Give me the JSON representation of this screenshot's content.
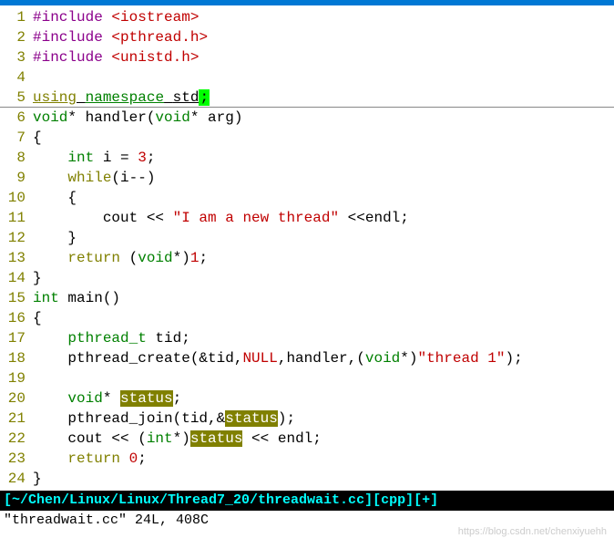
{
  "lines": {
    "l1": {
      "n": "1",
      "preproc": "#include ",
      "header": "<iostream>"
    },
    "l2": {
      "n": "2",
      "preproc": "#include ",
      "header": "<pthread.h>"
    },
    "l3": {
      "n": "3",
      "preproc": "#include ",
      "header": "<unistd.h>"
    },
    "l4": {
      "n": "4"
    },
    "l5": {
      "n": "5",
      "kw1": "using",
      "sp1": " ",
      "kw2": "namespace",
      "sp2": " ",
      "ns": "std",
      "semi": ";"
    },
    "l6": {
      "n": "6",
      "t1": "void",
      "p1": "* handler(",
      "t2": "void",
      "p2": "* arg)"
    },
    "l7": {
      "n": "7",
      "p": "{"
    },
    "l8": {
      "n": "8",
      "pad": "    ",
      "t": "int",
      "p": " i = ",
      "num": "3",
      "semi": ";"
    },
    "l9": {
      "n": "9",
      "pad": "    ",
      "kw": "while",
      "p": "(i--)"
    },
    "l10": {
      "n": "10",
      "pad": "    ",
      "p": "{"
    },
    "l11": {
      "n": "11",
      "pad": "        ",
      "p1": "cout << ",
      "str": "\"I am a new thread\"",
      "p2": " <<endl;"
    },
    "l12": {
      "n": "12",
      "pad": "    ",
      "p": "}"
    },
    "l13": {
      "n": "13",
      "pad": "    ",
      "kw": "return",
      "p1": " (",
      "t": "void",
      "p2": "*)",
      "num": "1",
      "semi": ";"
    },
    "l14": {
      "n": "14",
      "p": "}"
    },
    "l15": {
      "n": "15",
      "t": "int",
      "p": " main()"
    },
    "l16": {
      "n": "16",
      "p": "{"
    },
    "l17": {
      "n": "17",
      "pad": "    ",
      "t": "pthread_t",
      "p": " tid;"
    },
    "l18": {
      "n": "18",
      "pad": "    ",
      "p1": "pthread_create(&tid,",
      "null": "NULL",
      "p2": ",handler,(",
      "t": "void",
      "p3": "*)",
      "str": "\"thread 1\"",
      "p4": ");"
    },
    "l19": {
      "n": "19"
    },
    "l20": {
      "n": "20",
      "pad": "    ",
      "t": "void",
      "p1": "* ",
      "hl": "status",
      "p2": ";"
    },
    "l21": {
      "n": "21",
      "pad": "    ",
      "p1": "pthread_join(tid,&",
      "hl": "status",
      "p2": ");"
    },
    "l22": {
      "n": "22",
      "pad": "    ",
      "p1": "cout << (",
      "t": "int",
      "p2": "*)",
      "hl": "status",
      "p3": " << endl;"
    },
    "l23": {
      "n": "23",
      "pad": "    ",
      "kw": "return",
      "sp": " ",
      "num": "0",
      "semi": ";"
    },
    "l24": {
      "n": "24",
      "p": "}"
    }
  },
  "status_bar": "[~/Chen/Linux/Linux/Thread7_20/threadwait.cc][cpp][+]",
  "status_info": "\"threadwait.cc\" 24L, 408C",
  "watermark": "https://blog.csdn.net/chenxiyuehh"
}
